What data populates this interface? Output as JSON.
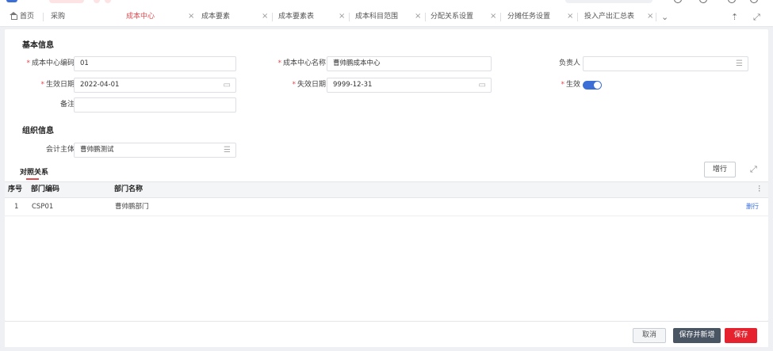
{
  "tabs": [
    {
      "label": "首页",
      "closable": false,
      "active": false
    },
    {
      "label": "采购",
      "closable": false,
      "active": false
    },
    {
      "label": "成本中心",
      "closable": true,
      "active": true
    },
    {
      "label": "成本要素",
      "closable": true,
      "active": false
    },
    {
      "label": "成本要素表",
      "closable": true,
      "active": false
    },
    {
      "label": "成本科目范围",
      "closable": true,
      "active": false
    },
    {
      "label": "分配关系设置",
      "closable": true,
      "active": false
    },
    {
      "label": "分摊任务设置",
      "closable": true,
      "active": false
    },
    {
      "label": "投入产出汇总表",
      "closable": true,
      "active": false
    }
  ],
  "tab_close_glyph": "×",
  "tabbar_icons": {
    "more": "chevron-down-icon",
    "pin": "pin-icon",
    "fullscreen": "fullscreen-icon"
  },
  "basic": {
    "title": "基本信息",
    "code_label": "成本中心编码",
    "code_value": "01",
    "name_label": "成本中心名称",
    "name_value": "曹帅鹏成本中心",
    "owner_label": "负责人",
    "owner_value": "",
    "start_label": "生效日期",
    "start_value": "2022-04-01",
    "end_label": "失效日期",
    "end_value": "9999-12-31",
    "active_label": "生效",
    "active_on": true,
    "remark_label": "备注",
    "remark_value": ""
  },
  "org": {
    "title": "组织信息",
    "entity_label": "会计主体",
    "entity_value": "曹帅鹏测试"
  },
  "mapping": {
    "tab_label": "对照关系",
    "add_row_label": "增行",
    "columns": {
      "seq": "序号",
      "dept_code": "部门编码",
      "dept_name": "部门名称"
    },
    "rows": [
      {
        "seq": "1",
        "dept_code": "CSP01",
        "dept_name": "曹帅鹏部门",
        "action": "删行"
      }
    ]
  },
  "footer": {
    "cancel_label": "取消",
    "save_new_label": "保存并新增",
    "save_label": "保存"
  },
  "colors": {
    "accent_red": "#e5484d",
    "primary_blue": "#3b6fd6",
    "dark_button": "#4a5563",
    "save_red": "#e5222d"
  }
}
